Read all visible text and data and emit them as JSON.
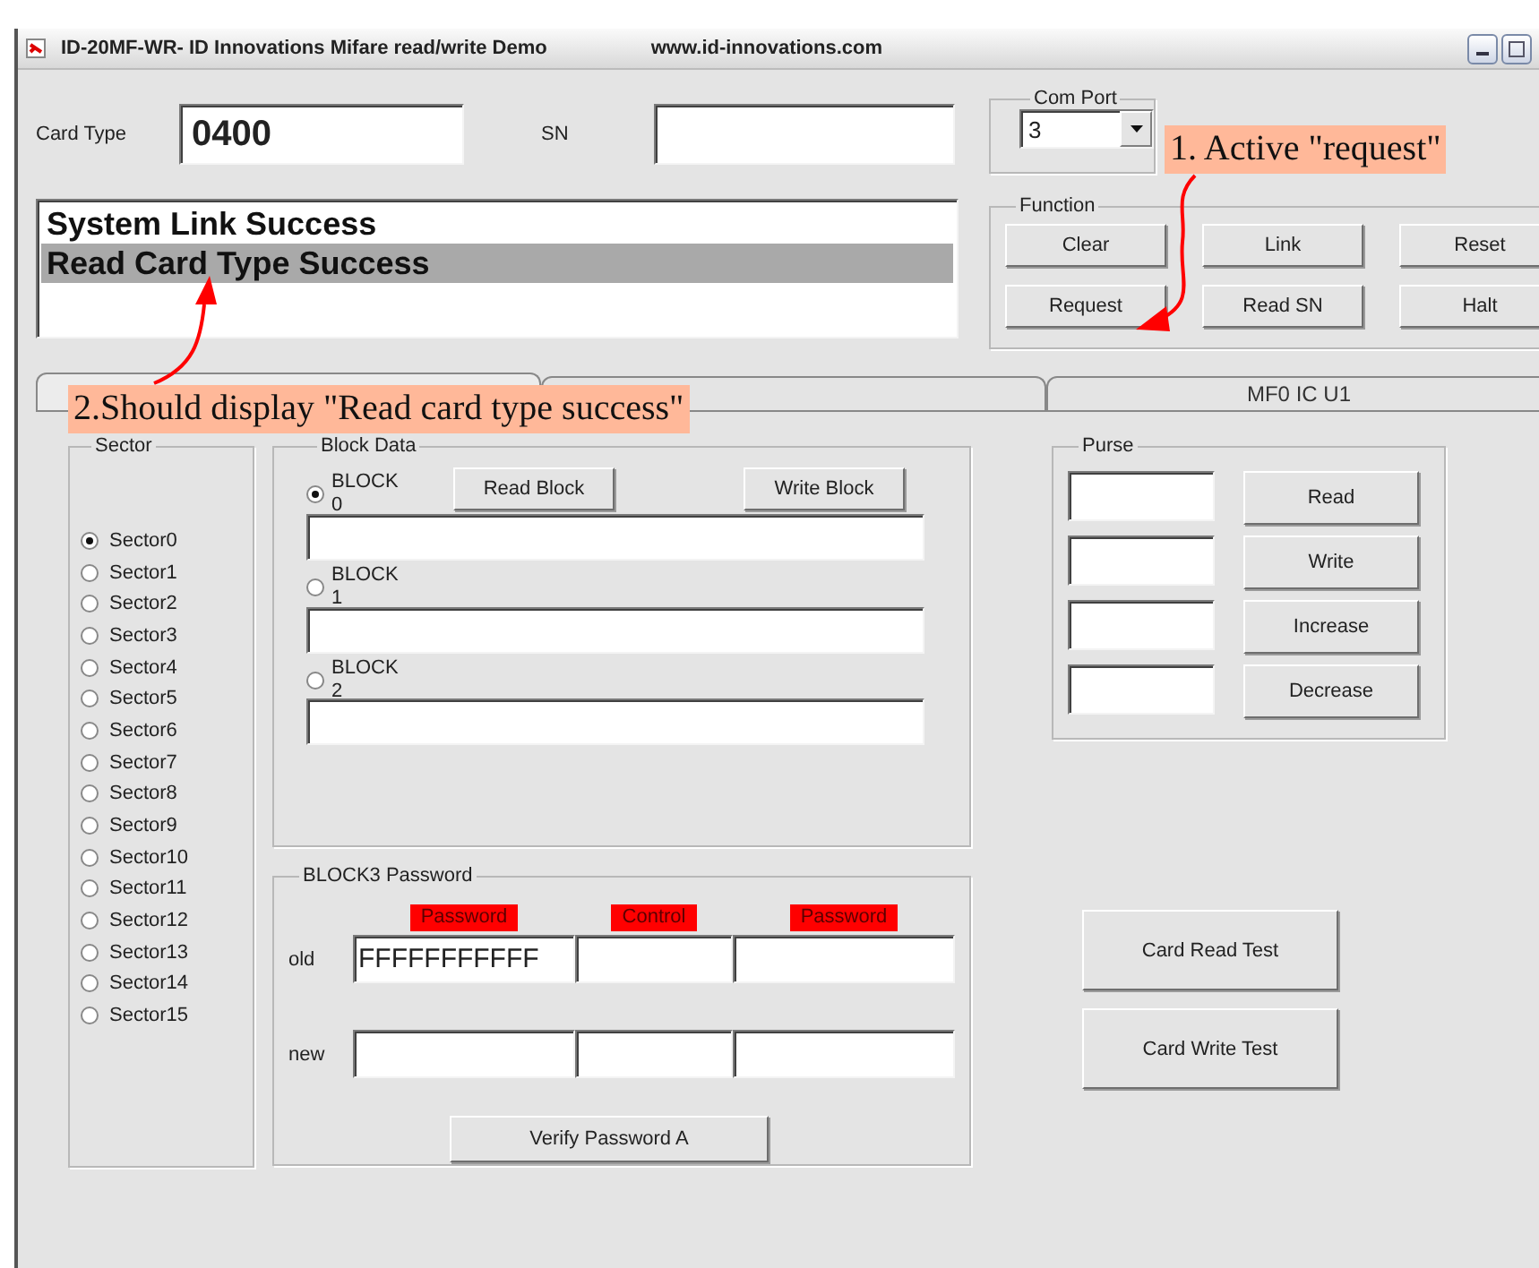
{
  "window": {
    "title": "ID-20MF-WR- ID Innovations Mifare read/write Demo",
    "website": "www.id-innovations.com"
  },
  "card_type": {
    "label": "Card Type",
    "value": "0400"
  },
  "sn": {
    "label": "SN"
  },
  "log": [
    {
      "text": "System Link Success",
      "selected": false
    },
    {
      "text": "Read Card Type Success",
      "selected": true
    }
  ],
  "com_port": {
    "label": "Com Port",
    "value": "3"
  },
  "function": {
    "label": "Function",
    "buttons": [
      "Clear",
      "Link",
      "Reset",
      "Request",
      "Read SN",
      "Halt"
    ]
  },
  "tabs": [
    {
      "selected": true
    },
    {
      "selected": false
    },
    {
      "label": "MF0 IC U1",
      "selected": false
    }
  ],
  "sector": {
    "label": "Sector",
    "items": [
      {
        "label": "Sector0",
        "selected": true
      },
      {
        "label": "Sector1",
        "selected": false
      },
      {
        "label": "Sector2",
        "selected": false
      },
      {
        "label": "Sector3",
        "selected": false
      },
      {
        "label": "Sector4",
        "selected": false
      },
      {
        "label": "Sector5",
        "selected": false
      },
      {
        "label": "Sector6",
        "selected": false
      },
      {
        "label": "Sector7",
        "selected": false
      },
      {
        "label": "Sector8",
        "selected": false
      },
      {
        "label": "Sector9",
        "selected": false
      },
      {
        "label": "Sector10",
        "selected": false
      },
      {
        "label": "Sector11",
        "selected": false
      },
      {
        "label": "Sector12",
        "selected": false
      },
      {
        "label": "Sector13",
        "selected": false
      },
      {
        "label": "Sector14",
        "selected": false
      },
      {
        "label": "Sector15",
        "selected": false
      }
    ]
  },
  "block_data": {
    "label": "Block Data",
    "buttons": [
      "Read Block",
      "Write Block"
    ],
    "blocks": [
      {
        "label": "BLOCK0",
        "selected": true
      },
      {
        "label": "BLOCK1",
        "selected": false
      },
      {
        "label": "BLOCK2",
        "selected": false
      }
    ]
  },
  "block3_password": {
    "label": "BLOCK3 Password",
    "columns": [
      "Password",
      "Control",
      "Password"
    ],
    "rows": [
      {
        "label": "old",
        "values": [
          "FFFFFFFFFFF"
        ]
      },
      {
        "label": "new"
      }
    ],
    "button": "Verify Password A"
  },
  "purse": {
    "label": "Purse",
    "buttons": [
      "Read",
      "Write",
      "Increase",
      "Decrease"
    ]
  },
  "test_buttons": [
    "Card Read Test",
    "Card Write Test"
  ],
  "annotations": [
    {
      "text": "1. Active \"request\""
    },
    {
      "text": "2.Should display \"Read card type success\""
    }
  ]
}
